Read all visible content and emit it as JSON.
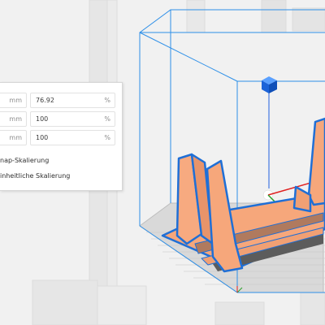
{
  "scale_panel": {
    "rows": [
      {
        "mm": "",
        "mm_unit": "mm",
        "percent": "76.92",
        "percent_unit": "%"
      },
      {
        "mm": "",
        "mm_unit": "mm",
        "percent": "100",
        "percent_unit": "%"
      },
      {
        "mm": "",
        "mm_unit": "mm",
        "percent": "100",
        "percent_unit": "%"
      }
    ],
    "snap_scaling_label": "nap-Skalierung",
    "uniform_scaling_label": "inheitliche Skalierung"
  },
  "colors": {
    "model_fill": "#f6a77b",
    "model_outline": "#1f6fd6",
    "bounding_box": "#2d8fe8",
    "build_plate": "#d9d9d9",
    "axis_x": "#e02020",
    "axis_y": "#2aa02a",
    "axis_z": "#2060e0"
  },
  "icons": [
    "move-handle-icon"
  ]
}
